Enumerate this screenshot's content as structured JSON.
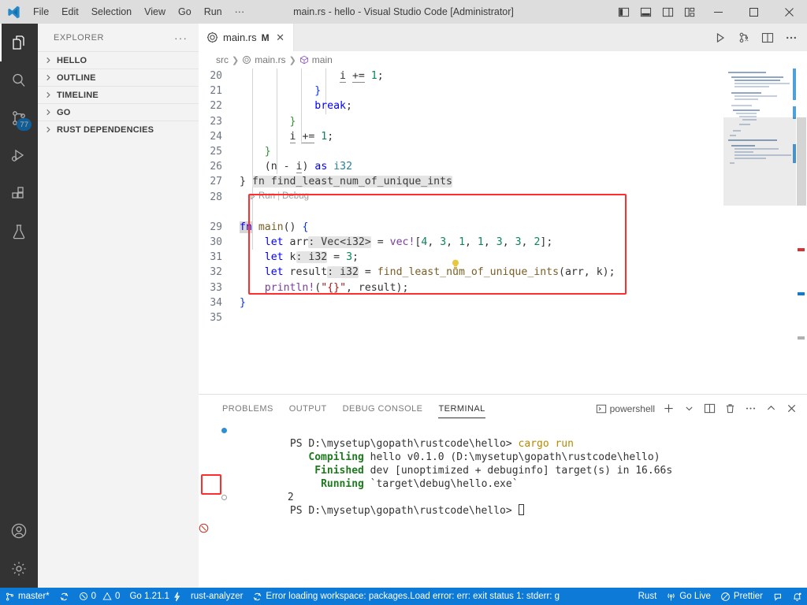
{
  "window": {
    "title": "main.rs - hello - Visual Studio Code [Administrator]",
    "logo_icon": "vscode-logo-icon",
    "menus": [
      "File",
      "Edit",
      "Selection",
      "View",
      "Go",
      "Run",
      "···"
    ],
    "layout_buttons": [
      {
        "name": "toggle-primary-sidebar-icon"
      },
      {
        "name": "toggle-panel-icon"
      },
      {
        "name": "toggle-secondary-sidebar-icon"
      },
      {
        "name": "customize-layout-icon"
      }
    ],
    "controls": [
      {
        "name": "minimize-button",
        "glyph": "─"
      },
      {
        "name": "maximize-button",
        "glyph": "□"
      },
      {
        "name": "close-button",
        "glyph": "✕"
      }
    ]
  },
  "activity_bar": {
    "items": [
      {
        "name": "explorer",
        "icon": "files-icon",
        "active": true,
        "badge": ""
      },
      {
        "name": "search",
        "icon": "search-icon",
        "active": false,
        "badge": ""
      },
      {
        "name": "source-control",
        "icon": "source-control-icon",
        "active": false,
        "badge": "77"
      },
      {
        "name": "run-and-debug",
        "icon": "run-debug-icon",
        "active": false,
        "badge": ""
      },
      {
        "name": "extensions",
        "icon": "extensions-icon",
        "active": false,
        "badge": ""
      },
      {
        "name": "testing",
        "icon": "beaker-icon",
        "active": false,
        "badge": ""
      }
    ],
    "bottom": [
      {
        "name": "accounts",
        "icon": "account-icon"
      },
      {
        "name": "manage",
        "icon": "gear-icon"
      }
    ]
  },
  "sidebar": {
    "title": "EXPLORER",
    "more_actions": "···",
    "sections": [
      {
        "label": "HELLO",
        "expanded": false
      },
      {
        "label": "OUTLINE",
        "expanded": false
      },
      {
        "label": "TIMELINE",
        "expanded": false
      },
      {
        "label": "GO",
        "expanded": false
      },
      {
        "label": "RUST DEPENDENCIES",
        "expanded": false
      }
    ]
  },
  "editor": {
    "tab": {
      "label": "main.rs",
      "dirty_indicator": "M",
      "close_glyph": "✕",
      "icon": "rust-file-icon"
    },
    "actions": [
      {
        "name": "run-code-button",
        "icon": "play-icon"
      },
      {
        "name": "run-with-debug-button",
        "icon": "debug-icon"
      },
      {
        "name": "split-editor-button",
        "icon": "split-editor-icon"
      },
      {
        "name": "more-actions-button",
        "icon": "ellipsis-icon"
      }
    ],
    "breadcrumbs": [
      {
        "label": "src",
        "icon": ""
      },
      {
        "label": "main.rs",
        "icon": "rust-file-icon"
      },
      {
        "label": "main",
        "icon": "symbol-method-icon"
      }
    ],
    "codelens": {
      "run": "Run",
      "separator": "|",
      "debug": "Debug"
    },
    "lightbulb_line": "28",
    "lines": [
      {
        "n": "20"
      },
      {
        "n": "21"
      },
      {
        "n": "22"
      },
      {
        "n": "23"
      },
      {
        "n": "24"
      },
      {
        "n": "25"
      },
      {
        "n": "26"
      },
      {
        "n": "27"
      },
      {
        "n": "28"
      },
      {
        "n": "29"
      },
      {
        "n": "30"
      },
      {
        "n": "31"
      },
      {
        "n": "32"
      },
      {
        "n": "33"
      },
      {
        "n": "34"
      },
      {
        "n": "35"
      }
    ],
    "source_text": [
      "                i += 1;",
      "            }",
      "            break;",
      "        }",
      "        i += 1;",
      "    }",
      "    (n - i) as i32",
      "} fn find_least_num_of_unique_ints",
      "",
      "fn main() {",
      "    let arr: Vec<i32> = vec![4, 3, 1, 1, 3, 3, 2];",
      "    let k: i32 = 3;",
      "    let result: i32 = find_least_num_of_unique_ints(arr, k);",
      "    println!(\"{}\", result);",
      "}",
      ""
    ],
    "inlay_hints": [
      "Vec<i32>",
      "i32",
      "i32"
    ],
    "closing_hint": "fn find_least_num_of_unique_ints"
  },
  "panel": {
    "tabs": [
      {
        "label": "PROBLEMS",
        "active": false
      },
      {
        "label": "OUTPUT",
        "active": false
      },
      {
        "label": "DEBUG CONSOLE",
        "active": false
      },
      {
        "label": "TERMINAL",
        "active": true
      }
    ],
    "terminal_name": "powershell",
    "actions": [
      {
        "name": "new-terminal-button",
        "glyph": "+"
      },
      {
        "name": "terminal-profile-dropdown",
        "glyph": "⌄"
      },
      {
        "name": "split-terminal-button",
        "glyph": "split"
      },
      {
        "name": "kill-terminal-button",
        "glyph": "trash"
      },
      {
        "name": "panel-more-actions-button",
        "glyph": "···"
      },
      {
        "name": "maximize-panel-button",
        "glyph": "⌃"
      },
      {
        "name": "close-panel-button",
        "glyph": "✕"
      }
    ]
  },
  "terminal": {
    "prompt": "PS D:\\mysetup\\gopath\\rustcode\\hello>",
    "command": "cargo run",
    "lines": [
      {
        "label": "Compiling",
        "rest": " hello v0.1.0 (D:\\mysetup\\gopath\\rustcode\\hello)"
      },
      {
        "label": "Finished",
        "rest": " dev [unoptimized + debuginfo] target(s) in 16.66s"
      },
      {
        "label": "Running",
        "rest": " `target\\debug\\hello.exe`"
      }
    ],
    "program_output": "2",
    "cursor": "▊"
  },
  "status_bar": {
    "left": [
      {
        "name": "remote-branch",
        "icon": "source-control-icon",
        "label": "master*"
      },
      {
        "name": "sync-changes",
        "icon": "sync-icon",
        "label": ""
      },
      {
        "name": "problems",
        "icon": "error-warning-icon",
        "label": "0  0",
        "errors": "0",
        "warnings": "0"
      },
      {
        "name": "go-version",
        "icon": "",
        "label": "Go 1.21.1"
      },
      {
        "name": "rust-analyzer",
        "icon": "",
        "label": "rust-analyzer"
      },
      {
        "name": "workspace-error",
        "icon": "sync-icon",
        "label": "Error loading workspace: packages.Load error: err: exit status 1: stderr: g"
      }
    ],
    "right": [
      {
        "name": "language-mode",
        "icon": "",
        "label": "Rust"
      },
      {
        "name": "go-live",
        "icon": "broadcast-icon",
        "label": "Go Live"
      },
      {
        "name": "prettier",
        "icon": "no-entry-icon",
        "label": "Prettier"
      },
      {
        "name": "feedback",
        "icon": "feedback-icon",
        "label": ""
      },
      {
        "name": "notifications",
        "icon": "bell-dot-icon",
        "label": ""
      }
    ]
  },
  "annotations": {
    "main_fn_box_color": "#ff2d2d",
    "output_box_color": "#ff2d2d"
  }
}
